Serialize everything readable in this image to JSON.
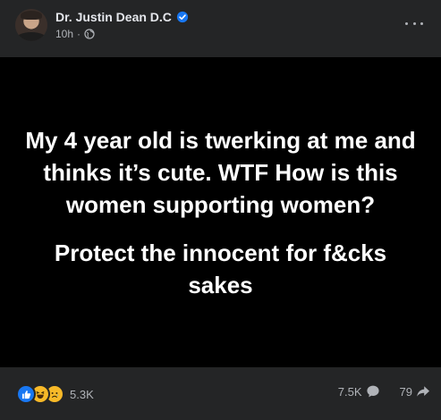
{
  "post": {
    "author": "Dr. Justin Dean D.C",
    "verified": true,
    "timestamp": "10h",
    "separator": "·",
    "audience_icon": "globe-icon",
    "menu_icon": "more-options-icon",
    "content": {
      "paragraphs": [
        "My 4 year old is twerking at me and thinks it’s cute. WTF How is this women supporting women?",
        "Protect the innocent for f&cks sakes"
      ],
      "background_color": "#000000",
      "text_color": "#ffffff"
    },
    "reactions": {
      "types": [
        "like-icon",
        "haha-icon",
        "sad-icon"
      ],
      "count": "5.3K"
    },
    "stats": {
      "comments": "7.5K",
      "comment_icon": "comment-icon",
      "shares": "79",
      "share_icon": "share-icon"
    }
  },
  "colors": {
    "card_bg": "#242526",
    "primary_text": "#e4e6eb",
    "secondary_text": "#b0b3b8",
    "verified_blue": "#1877f2",
    "like_blue": "#1877f2",
    "reaction_yellow": "#f7b928"
  }
}
